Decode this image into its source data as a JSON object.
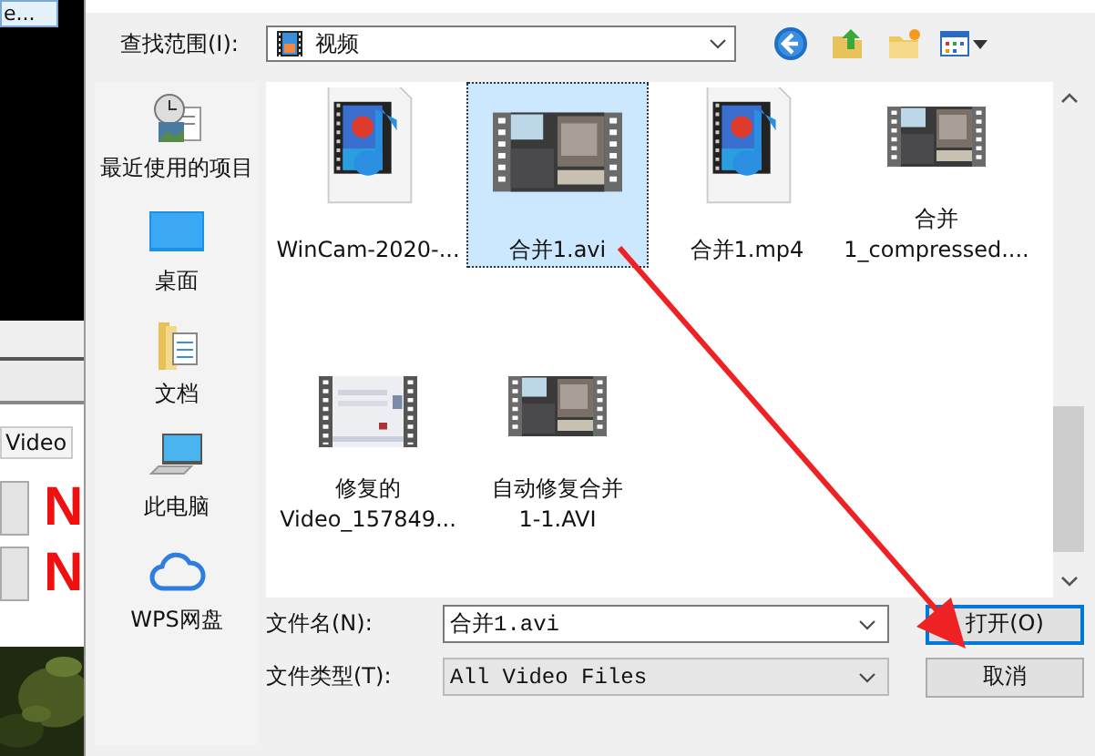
{
  "background_app": {
    "button": "e...",
    "tab": "Video",
    "markers": [
      "N",
      "N"
    ]
  },
  "toolbar": {
    "label": "查找范围(I):",
    "location": "视频"
  },
  "sidebar": {
    "items": [
      {
        "label": "最近使用的项目",
        "kind": "recent"
      },
      {
        "label": "桌面",
        "kind": "desktop"
      },
      {
        "label": "文档",
        "kind": "documents"
      },
      {
        "label": "此电脑",
        "kind": "computer"
      },
      {
        "label": "WPS网盘",
        "kind": "cloud"
      }
    ]
  },
  "files": [
    {
      "lines": [
        "WinCam-2020-..."
      ],
      "kind": "media",
      "selected": false
    },
    {
      "lines": [
        "合并1.avi"
      ],
      "kind": "video-dark",
      "selected": true
    },
    {
      "lines": [
        "合并1.mp4"
      ],
      "kind": "media",
      "selected": false
    },
    {
      "lines": [
        "合并",
        "1_compressed...."
      ],
      "kind": "video-dark",
      "selected": false
    },
    {
      "lines": [
        "修复的",
        "Video_157849..."
      ],
      "kind": "video-light",
      "selected": false
    },
    {
      "lines": [
        "自动修复合并",
        "1-1.AVI"
      ],
      "kind": "video-dark",
      "selected": false
    }
  ],
  "form": {
    "filename_label": "文件名(N):",
    "filename": "合并1.avi",
    "filetype_label": "文件类型(T):",
    "filetype": "All Video Files"
  },
  "buttons": [
    {
      "label": "打开(O)",
      "default": true
    },
    {
      "label": "取消",
      "default": false
    }
  ]
}
